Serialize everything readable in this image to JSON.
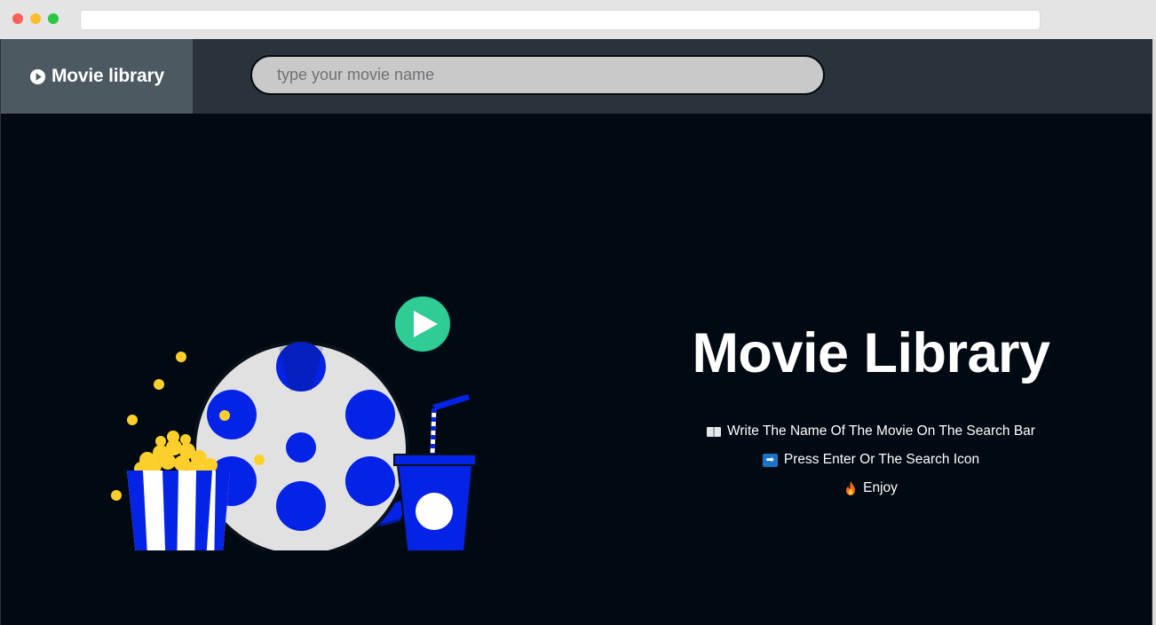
{
  "navbar": {
    "brand_label": "Movie library",
    "brand_icon": "play-circle-icon"
  },
  "search": {
    "placeholder": "type your movie name",
    "value": ""
  },
  "hero": {
    "title": "Movie Library",
    "steps": [
      {
        "icon": "open-book-icon",
        "text": "Write The Name Of The Movie On The Search Bar"
      },
      {
        "icon": "right-arrow-icon",
        "text": "Press Enter Or The Search Icon"
      },
      {
        "icon": "fire-icon",
        "text": "Enjoy"
      }
    ]
  },
  "colors": {
    "background": "#010912",
    "navbar": "#29333b",
    "brand_block": "#4c5961",
    "search_field": "#c9c9c9",
    "accent_blue": "#0423e6",
    "accent_green": "#2fcc94",
    "popcorn_yellow": "#fccf2a",
    "reel_gray": "#e1e1e1"
  }
}
